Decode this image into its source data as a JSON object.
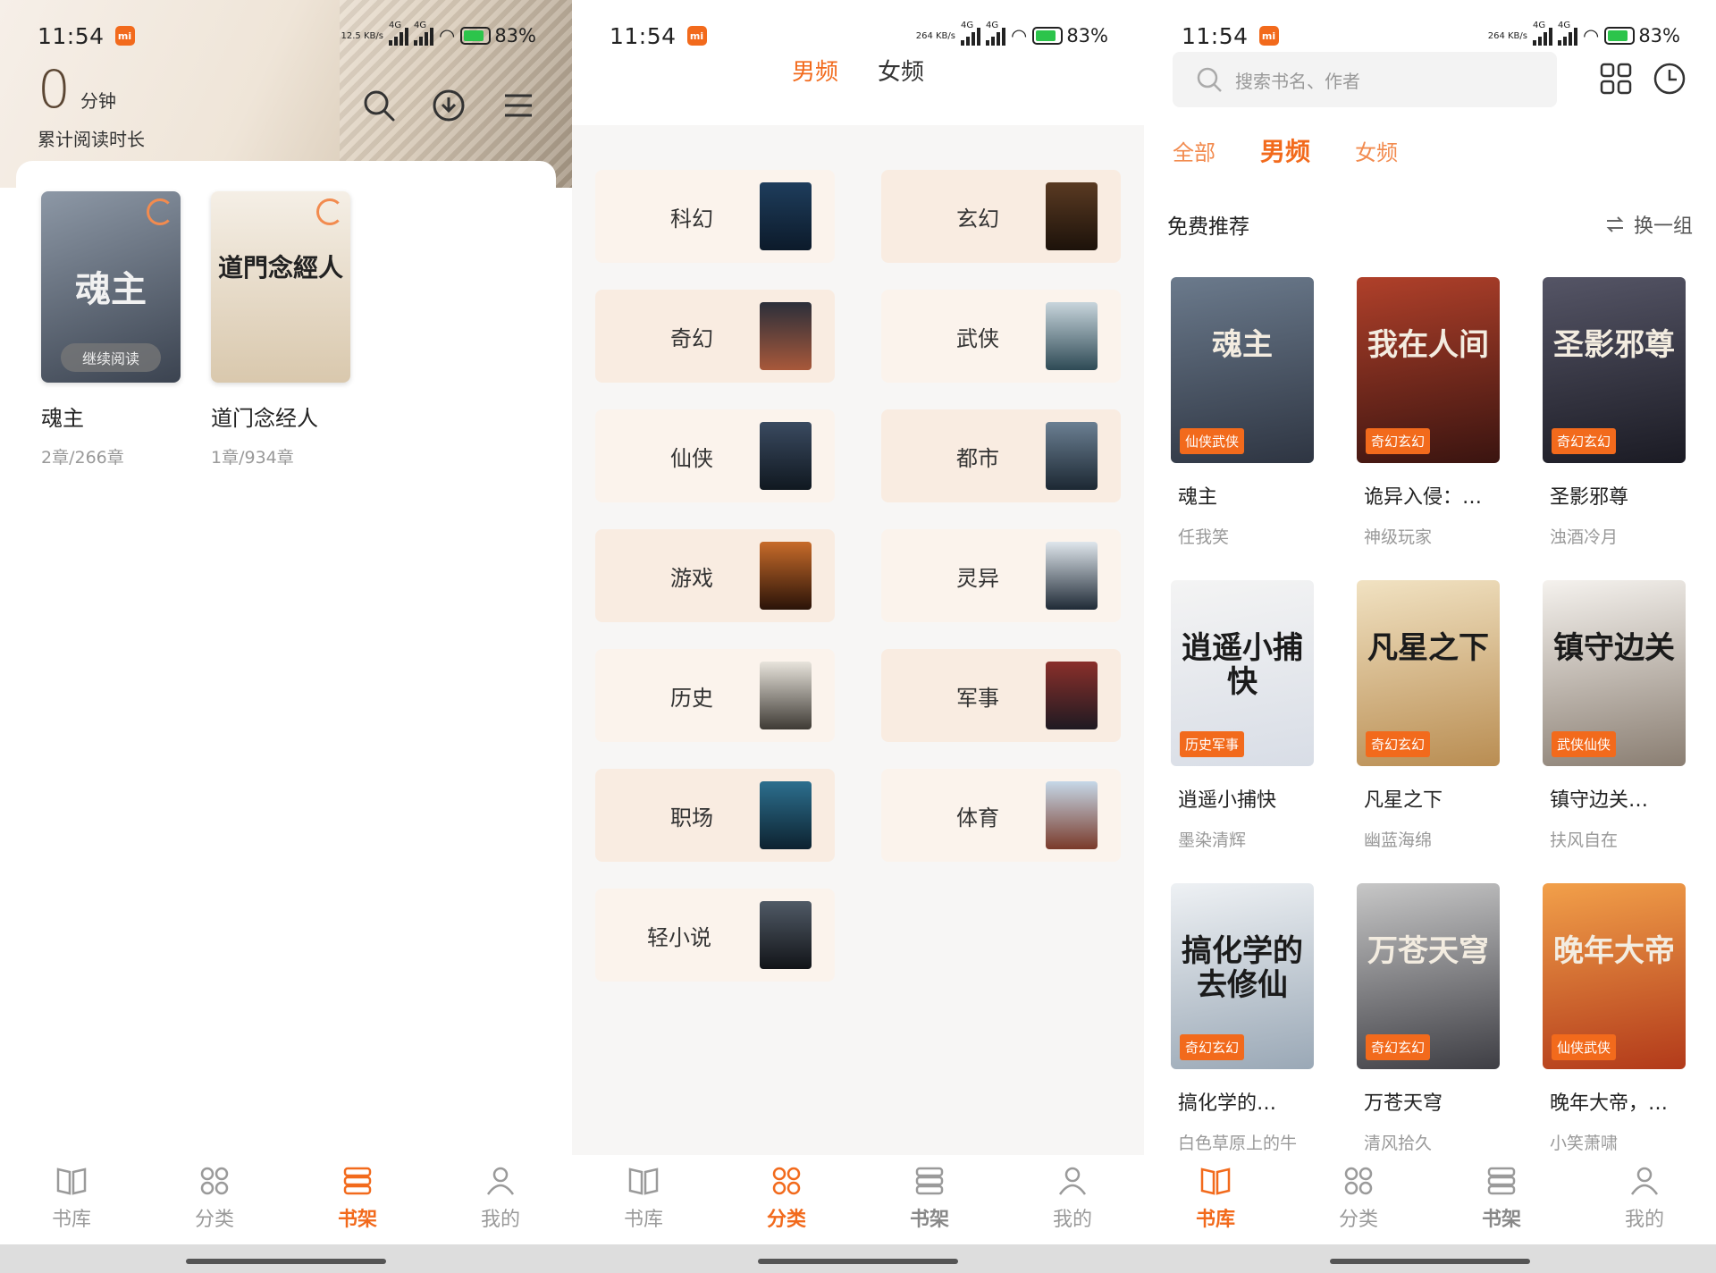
{
  "status": {
    "time": "11:54",
    "battery": "83%",
    "net_s1": "12.5 KB/s",
    "net_s2": "264 KB/s",
    "net_s3": "264 KB/s",
    "signal": "4G"
  },
  "shelf": {
    "reading_value": "0",
    "reading_unit": "分钟",
    "reading_label": "累计阅读时长",
    "continue_label": "继续阅读",
    "books": [
      {
        "title": "魂主",
        "progress": "2章/266章",
        "cover_text": "魂主"
      },
      {
        "title": "道门念经人",
        "progress": "1章/934章",
        "cover_text": "道門念經人"
      }
    ]
  },
  "categories": {
    "tabs": [
      "男频",
      "女频"
    ],
    "active_tab": "男频",
    "left": [
      "科幻",
      "奇幻",
      "仙侠",
      "游戏",
      "历史",
      "职场",
      "轻小说"
    ],
    "right": [
      "玄幻",
      "武侠",
      "都市",
      "灵异",
      "军事",
      "体育"
    ]
  },
  "library": {
    "search_placeholder": "搜索书名、作者",
    "tabs": [
      "全部",
      "男频",
      "女频"
    ],
    "section_title": "免费推荐",
    "refresh_label": "换一组",
    "books": [
      {
        "title": "魂主",
        "author": "任我笑",
        "tag": "仙侠武侠",
        "cover_text": "魂主",
        "c1": "#6b7a8c",
        "c2": "#2e3542"
      },
      {
        "title": "诡异入侵：…",
        "author": "神级玩家",
        "tag": "奇幻玄幻",
        "cover_text": "我在人间",
        "c1": "#b0402a",
        "c2": "#3a1410"
      },
      {
        "title": "圣影邪尊",
        "author": "浊酒冷月",
        "tag": "奇幻玄幻",
        "cover_text": "圣影邪尊",
        "c1": "#555566",
        "c2": "#1b1b24"
      },
      {
        "title": "逍遥小捕快",
        "author": "墨染清辉",
        "tag": "历史军事",
        "cover_text": "逍遥小捕快",
        "c1": "#f4f4f4",
        "c2": "#d8dde6"
      },
      {
        "title": "凡星之下",
        "author": "幽蓝海绵",
        "tag": "奇幻玄幻",
        "cover_text": "凡星之下",
        "c1": "#f1e2c2",
        "c2": "#b98d52"
      },
      {
        "title": "镇守边关…",
        "author": "扶风自在",
        "tag": "武侠仙侠",
        "cover_text": "镇守边关",
        "c1": "#f5f2ee",
        "c2": "#8a7e72"
      },
      {
        "title": "搞化学的…",
        "author": "白色草原上的牛",
        "tag": "奇幻玄幻",
        "cover_text": "搞化学的去修仙",
        "c1": "#eef1f4",
        "c2": "#9aa8b6"
      },
      {
        "title": "万苍天穹",
        "author": "清风拾久",
        "tag": "奇幻玄幻",
        "cover_text": "万苍天穹",
        "c1": "#c7c7c7",
        "c2": "#3e3e44"
      },
      {
        "title": "晚年大帝，…",
        "author": "小笑萧啸",
        "tag": "仙侠武侠",
        "cover_text": "晚年大帝",
        "c1": "#f2a04a",
        "c2": "#b23a1a"
      }
    ]
  },
  "nav": {
    "labels": [
      "书库",
      "分类",
      "书架",
      "我的"
    ],
    "active_s1": "书架",
    "active_s2": "分类",
    "active_s3": "书库"
  },
  "colors": {
    "accent": "#f26a1c",
    "muted": "#9a9a9a"
  }
}
